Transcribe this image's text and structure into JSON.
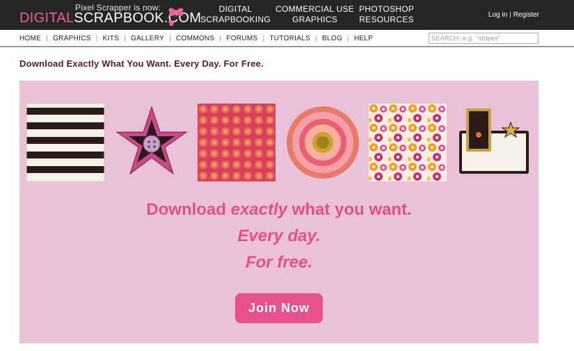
{
  "logo": {
    "tagline": "Pixel Scrapper is now:",
    "name_digital": "DIGITAL",
    "name_scrap": "SCRAPBOOK.COM",
    "butterfly_icon": "butterfly-icon",
    "accent": "#e8609a"
  },
  "topnav": [
    {
      "line1": "DIGITAL",
      "line2": "SCRAPBOOKING"
    },
    {
      "line1": "COMMERCIAL USE",
      "line2": "GRAPHICS"
    },
    {
      "line1": "PHOTOSHOP",
      "line2": "RESOURCES"
    }
  ],
  "auth": {
    "login": "Log in",
    "separator": "|",
    "register": "Register"
  },
  "subnav": [
    "HOME",
    "GRAPHICS",
    "KITS",
    "GALLERY",
    "COMMONS",
    "FORUMS",
    "TUTORIALS",
    "BLOG",
    "HELP"
  ],
  "search": {
    "placeholder": "SEARCH: e.g. \"stripes\""
  },
  "headline": "Download Exactly What You Want. Every Day. For Free.",
  "banner": {
    "background": "#eac2d7",
    "line1_a": "Download ",
    "line1_em": "exactly",
    "line1_b": " what you want.",
    "line2": "Every day.",
    "line3": "For free.",
    "text_color": "#e2508a",
    "cta_label": "Join Now",
    "cta_color": "#e8508c"
  }
}
